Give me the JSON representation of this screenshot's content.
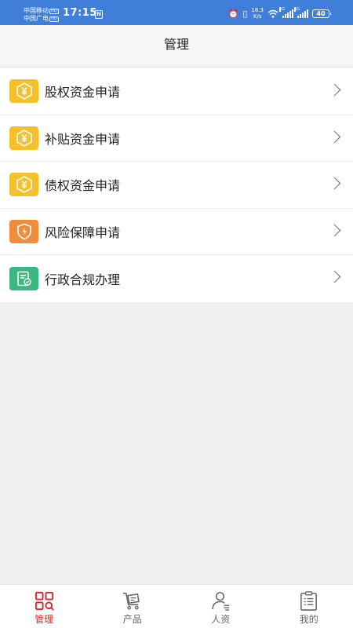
{
  "status_bar": {
    "carrier1": "中国移动",
    "carrier2": "中国广电",
    "carrier_tag": "HD",
    "time": "17:15",
    "nfc": "N",
    "speed_value": "18.3",
    "speed_unit": "K/s",
    "sig1_gen": "5G",
    "sig2_gen": "5G",
    "battery": "40"
  },
  "header": {
    "title": "管理"
  },
  "menu": {
    "items": [
      {
        "label": "股权资金申请",
        "icon": "yuan-icon",
        "color": "#f6c02b"
      },
      {
        "label": "补贴资金申请",
        "icon": "yuan-icon",
        "color": "#f6c02b"
      },
      {
        "label": "债权资金申请",
        "icon": "yuan-icon",
        "color": "#f6c02b"
      },
      {
        "label": "风险保障申请",
        "icon": "shield-lightning-icon",
        "color": "#ef8d3e"
      },
      {
        "label": "行政合规办理",
        "icon": "document-check-icon",
        "color": "#3bb882"
      }
    ]
  },
  "tabbar": {
    "active_color": "#d9272e",
    "tabs": [
      {
        "label": "管理",
        "icon": "grid-search-icon",
        "active": true
      },
      {
        "label": "产品",
        "icon": "cart-icon",
        "active": false
      },
      {
        "label": "人资",
        "icon": "person-icon",
        "active": false
      },
      {
        "label": "我的",
        "icon": "clipboard-icon",
        "active": false
      }
    ]
  }
}
